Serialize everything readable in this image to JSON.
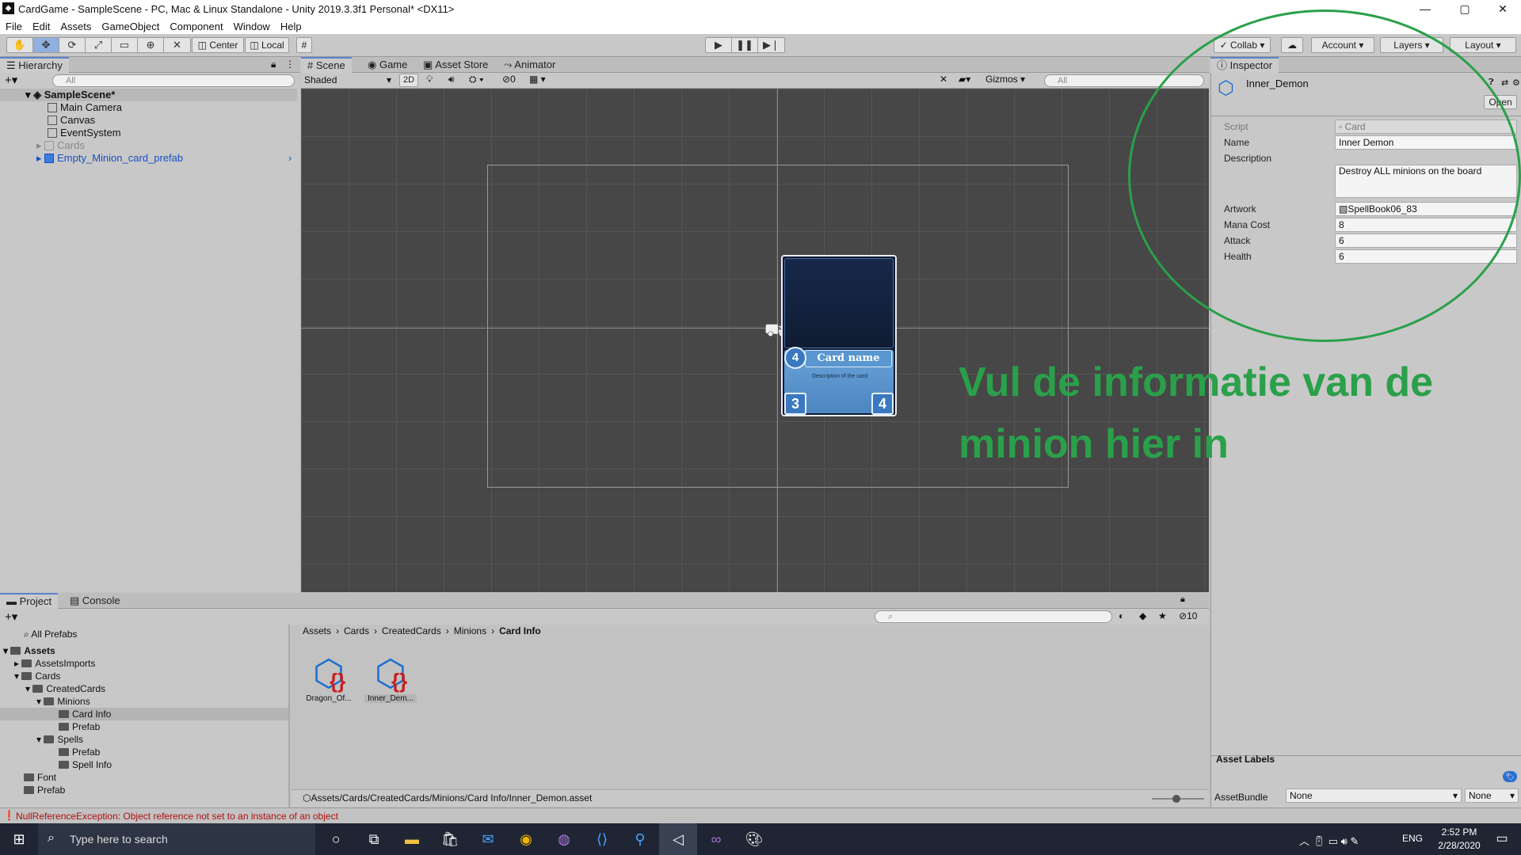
{
  "window": {
    "title": "CardGame - SampleScene - PC, Mac & Linux Standalone - Unity 2019.3.3f1 Personal* <DX11>",
    "controls": [
      "—",
      "▢",
      "✕"
    ]
  },
  "menu": [
    "File",
    "Edit",
    "Assets",
    "GameObject",
    "Component",
    "Window",
    "Help"
  ],
  "toolbar": {
    "pivot": "Center",
    "space": "Local",
    "collab": "Collab",
    "account": "Account",
    "layers": "Layers",
    "layout": "Layout"
  },
  "hierarchy": {
    "tab": "Hierarchy",
    "search_placeholder": "All",
    "scene": "SampleScene*",
    "items": [
      "Main Camera",
      "Canvas",
      "EventSystem",
      "Cards",
      "Empty_Minion_card_prefab"
    ]
  },
  "scene_tabs": [
    "Scene",
    "Game",
    "Asset Store",
    "Animator"
  ],
  "scene_toolbar": {
    "shading": "Shaded",
    "mode2d": "2D",
    "hidden_count": "0",
    "gizmos": "Gizmos",
    "search_placeholder": "All"
  },
  "card": {
    "mana": "4",
    "name": "Card name",
    "description": "Description of the card",
    "attack": "3",
    "health": "4"
  },
  "annotation": {
    "text_line1": "Vul de informatie van de",
    "text_line2": "minion hier in",
    "color": "#2aa04a"
  },
  "inspector": {
    "tab": "Inspector",
    "object_name": "Inner_Demon",
    "open_button": "Open",
    "fields": {
      "script_label": "Script",
      "script_value": "Card",
      "name_label": "Name",
      "name_value": "Inner Demon",
      "description_label": "Description",
      "description_value": "Destroy ALL minions on the board",
      "artwork_label": "Artwork",
      "artwork_value": "SpellBook06_83",
      "mana_label": "Mana Cost",
      "mana_value": "8",
      "attack_label": "Attack",
      "attack_value": "6",
      "health_label": "Health",
      "health_value": "6"
    },
    "asset_labels": "Asset Labels",
    "asset_bundle_label": "AssetBundle",
    "asset_bundle_value": "None",
    "asset_variant_value": "None"
  },
  "project": {
    "tabs": [
      "Project",
      "Console"
    ],
    "tree_top": [
      "All Prefabs"
    ],
    "tree": [
      {
        "label": "Assets",
        "bold": true
      },
      {
        "label": "AssetsImports"
      },
      {
        "label": "Cards"
      },
      {
        "label": "CreatedCards"
      },
      {
        "label": "Minions"
      },
      {
        "label": "Card Info",
        "selected": true
      },
      {
        "label": "Prefab"
      },
      {
        "label": "Spells"
      },
      {
        "label": "Prefab"
      },
      {
        "label": "Spell Info"
      },
      {
        "label": "Font"
      },
      {
        "label": "Prefab"
      }
    ],
    "breadcrumb": [
      "Assets",
      "Cards",
      "CreatedCards",
      "Minions",
      "Card Info"
    ],
    "assets": [
      "Dragon_Of...",
      "Inner_Dem..."
    ],
    "hidden_count": "10",
    "path": "Assets/Cards/CreatedCards/Minions/Card Info/Inner_Demon.asset"
  },
  "status": {
    "error": "NullReferenceException: Object reference not set to an instance of an object"
  },
  "taskbar": {
    "search_placeholder": "Type here to search",
    "language": "ENG",
    "time": "2:52 PM",
    "date": "2/28/2020"
  }
}
